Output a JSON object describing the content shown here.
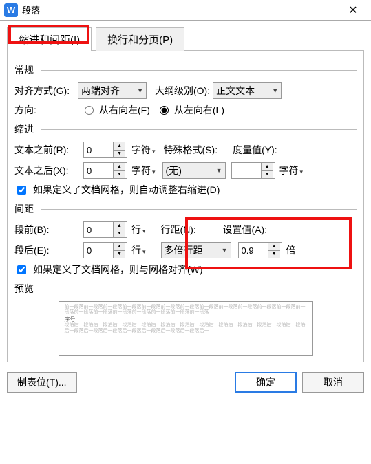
{
  "title": "段落",
  "tabs": {
    "indent": "缩进和间距(I)",
    "pagination": "换行和分页(P)"
  },
  "sections": {
    "general": "常规",
    "indent": "缩进",
    "spacing": "间距",
    "preview": "预览"
  },
  "general": {
    "align_label": "对齐方式(G):",
    "align_value": "两端对齐",
    "outline_label": "大纲级别(O):",
    "outline_value": "正文文本",
    "direction_label": "方向:",
    "rtl_label": "从右向左(F)",
    "ltr_label": "从左向右(L)"
  },
  "indent": {
    "before_label": "文本之前(R):",
    "before_value": "0",
    "before_unit": "字符",
    "after_label": "文本之后(X):",
    "after_value": "0",
    "after_unit": "字符",
    "special_label": "特殊格式(S):",
    "special_value": "(无)",
    "measure_label": "度量值(Y):",
    "measure_value": "",
    "measure_unit": "字符",
    "grid_cb": "如果定义了文档网格，则自动调整右缩进(D)"
  },
  "spacing": {
    "before_label": "段前(B):",
    "before_value": "0",
    "before_unit": "行",
    "after_label": "段后(E):",
    "after_value": "0",
    "after_unit": "行",
    "line_label": "行距(N):",
    "line_value": "多倍行距",
    "setat_label": "设置值(A):",
    "setat_value": "0.9",
    "setat_unit": "倍",
    "grid_cb": "如果定义了文档网格，则与网格对齐(W)"
  },
  "preview_body": "前一段落前一段落前一段落前一段落前一段落前一段落前一段落前一段落前一段落前一段落前一段落前一段落前一段落前一段落前一段落前一段落前一段落前一段落前一段落前一段落",
  "preview_dark": "序号",
  "preview_after": "段落后一段落后一段落后一段落后一段落后一段落后一段落后一段落后一段落后一段落后一段落后一段落后一段落后一段落后一段落后一段落后一段落后一段落后一段落后一段落后一",
  "footer": {
    "tabs": "制表位(T)...",
    "ok": "确定",
    "cancel": "取消"
  }
}
